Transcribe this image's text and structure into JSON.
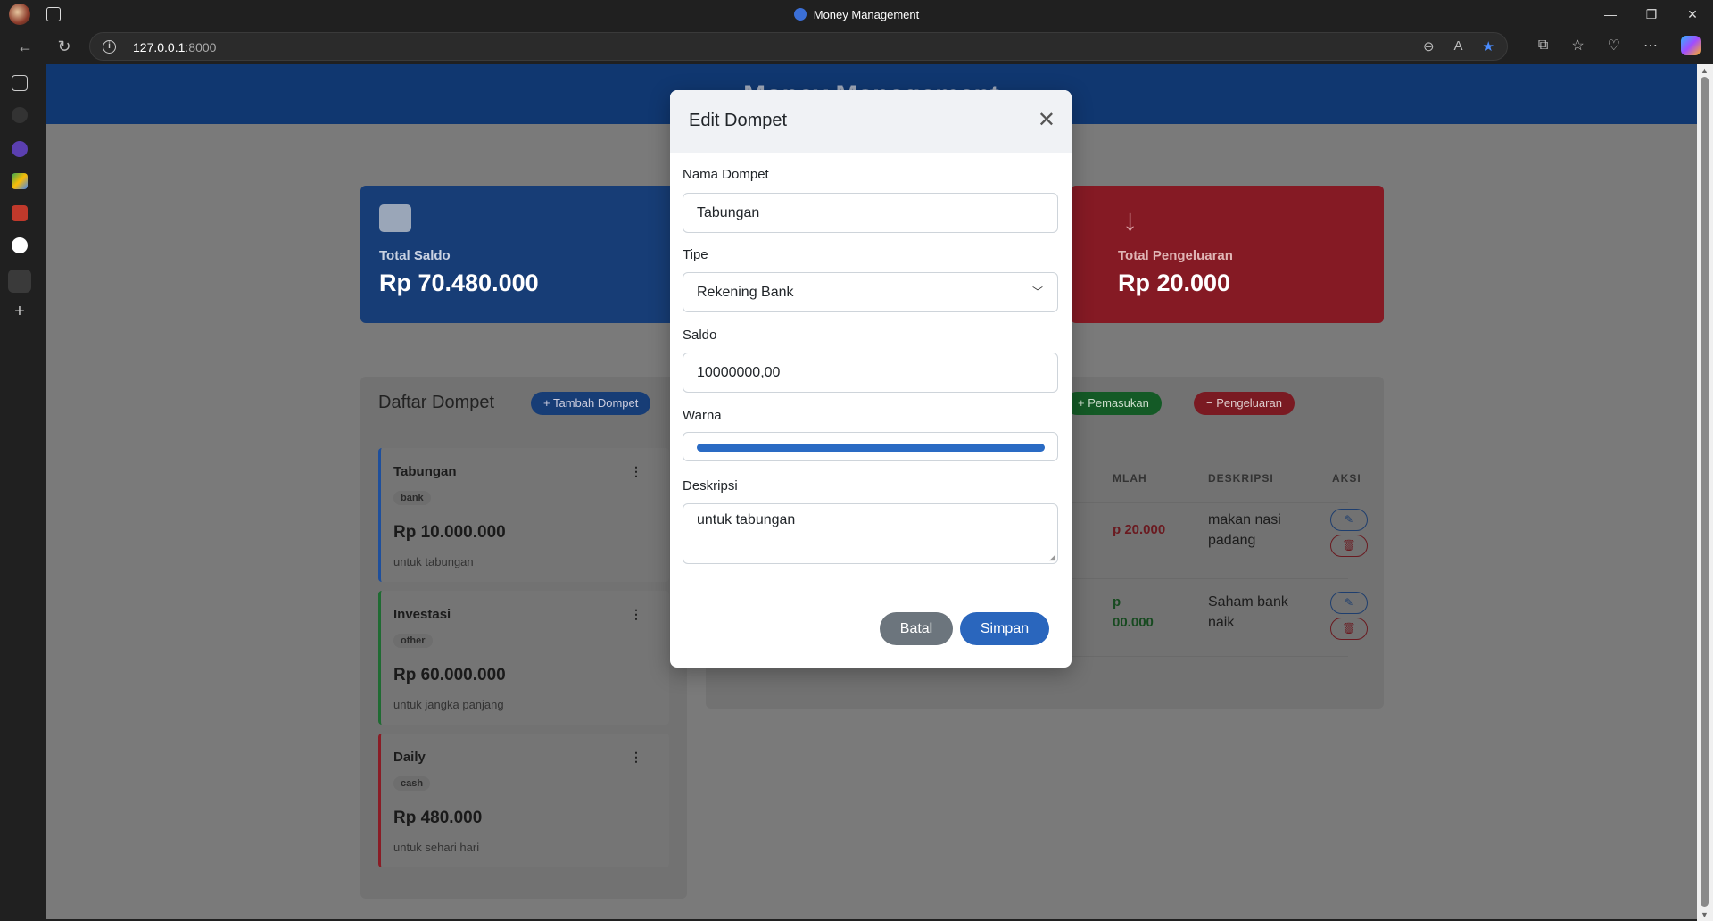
{
  "browser": {
    "window_title": "Money Management",
    "url_host": "127.0.0.1",
    "url_port": ":8000"
  },
  "header": {
    "title": "Money Management"
  },
  "summary": {
    "total_saldo_label": "Total Saldo",
    "total_saldo_value": "Rp 70.480.000",
    "total_pengeluaran_label": "Total Pengeluaran",
    "total_pengeluaran_value": "Rp 20.000"
  },
  "wallets_panel": {
    "title": "Daftar Dompet",
    "add_button": "+ Tambah Dompet",
    "wallets": [
      {
        "name": "Tabungan",
        "type": "bank",
        "amount": "Rp 10.000.000",
        "desc": "untuk tabungan",
        "color": "#1e4f9c"
      },
      {
        "name": "Investasi",
        "type": "other",
        "amount": "Rp 60.000.000",
        "desc": "untuk jangka panjang",
        "color": "#1f6b32"
      },
      {
        "name": "Daily",
        "type": "cash",
        "amount": "Rp 480.000",
        "desc": "untuk sehari hari",
        "color": "#8a1c25"
      }
    ]
  },
  "transactions_panel": {
    "income_button": "+ Pemasukan",
    "expense_button": "− Pengeluaran",
    "columns": [
      "MLAH",
      "DESKRIPSI",
      "AKSI"
    ],
    "rows": [
      {
        "amount": "p 20.000",
        "amount_type": "expense",
        "desc_line1": "makan nasi",
        "desc_line2": "padang"
      },
      {
        "amount_line1": "p",
        "amount_line2": "00.000",
        "amount_type": "income",
        "desc_line1": "Saham bank",
        "desc_line2": "naik"
      }
    ]
  },
  "modal": {
    "title": "Edit Dompet",
    "close_label": "✕",
    "fields": {
      "name_label": "Nama Dompet",
      "name_value": "Tabungan",
      "type_label": "Tipe",
      "type_value": "Rekening Bank",
      "saldo_label": "Saldo",
      "saldo_value": "10000000,00",
      "color_label": "Warna",
      "color_value": "#2a6bc4",
      "desc_label": "Deskripsi",
      "desc_value": "untuk tabungan"
    },
    "cancel_button": "Batal",
    "save_button": "Simpan"
  }
}
